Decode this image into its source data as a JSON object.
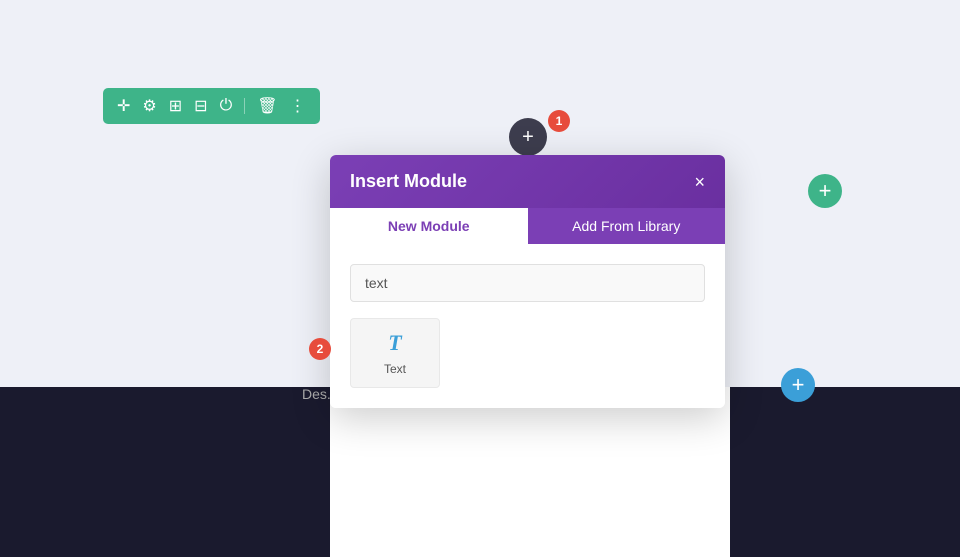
{
  "page": {
    "background_color": "#eef0f7"
  },
  "toolbar": {
    "icons": [
      "move",
      "settings",
      "layout",
      "grid",
      "power",
      "trash",
      "more"
    ]
  },
  "plus_dark": {
    "label": "+"
  },
  "badge_1": {
    "number": "1"
  },
  "badge_2": {
    "number": "2"
  },
  "plus_teal_right": {
    "label": "+"
  },
  "plus_blue_bottom": {
    "label": "+"
  },
  "modal": {
    "title": "Insert Module",
    "close_label": "×",
    "tabs": [
      {
        "label": "New Module",
        "active": true
      },
      {
        "label": "Add From Library",
        "active": false
      }
    ],
    "search": {
      "value": "text",
      "placeholder": "text"
    },
    "modules": [
      {
        "icon": "T",
        "label": "Text"
      }
    ]
  },
  "des_text": "Des..."
}
